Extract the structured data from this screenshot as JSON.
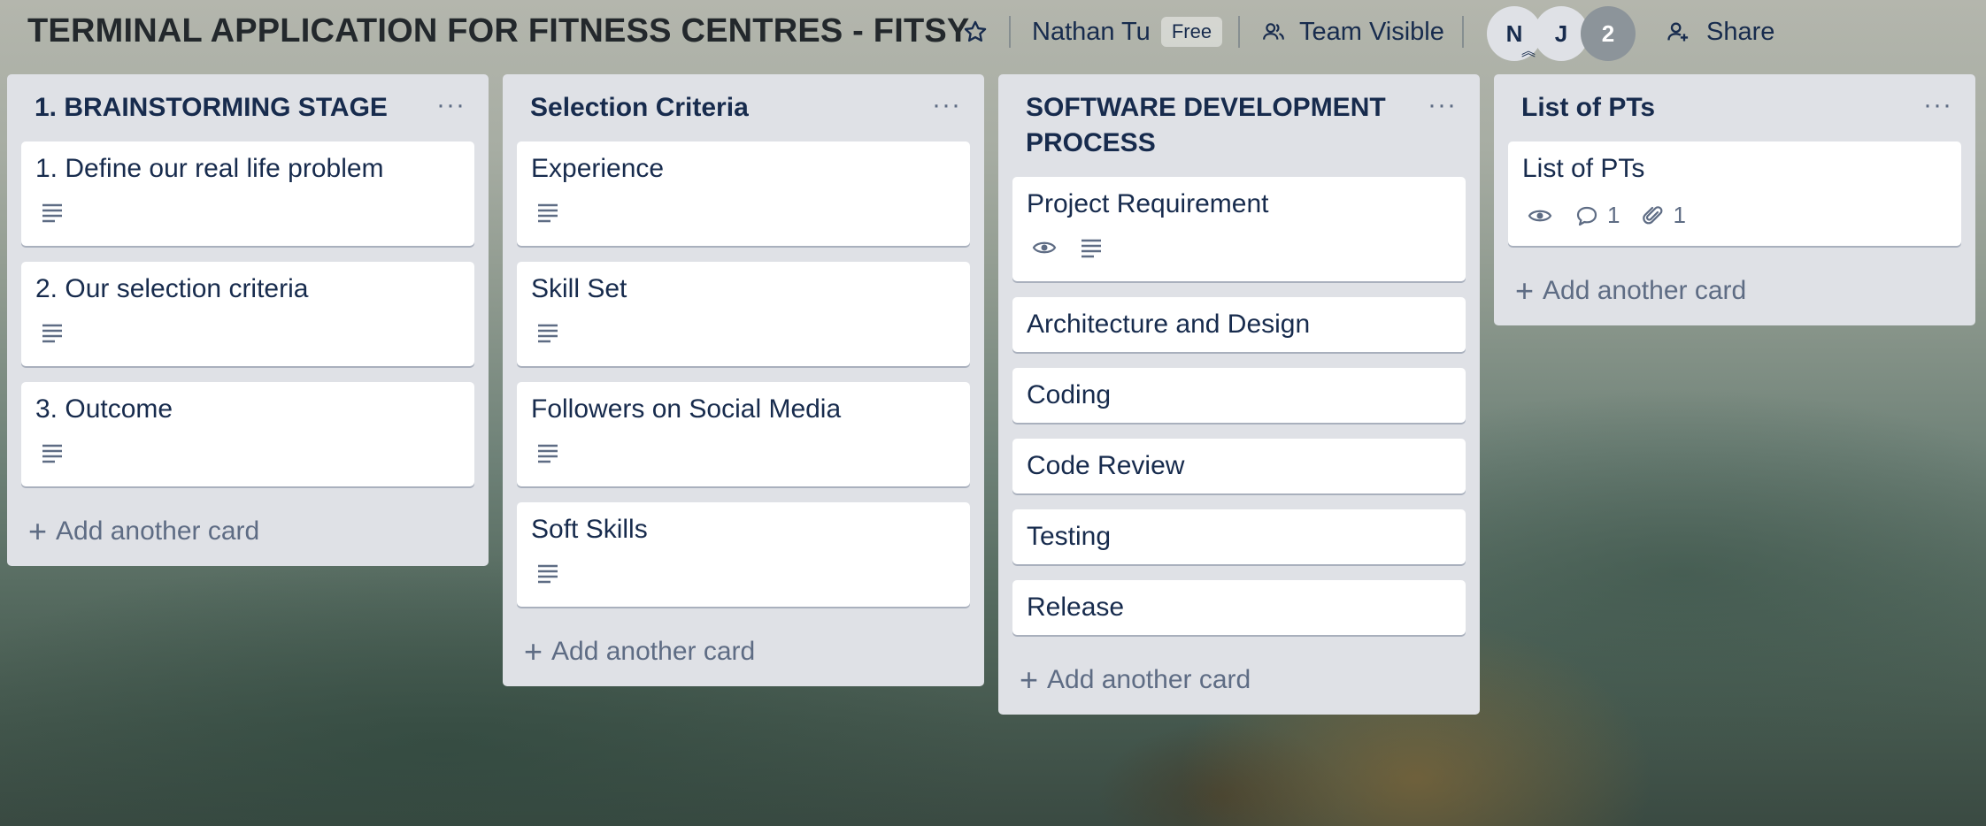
{
  "board": {
    "title": "TERMINAL APPLICATION FOR FITNESS CENTRES - FITSY",
    "owner": "Nathan Tu",
    "plan_badge": "Free",
    "visibility": "Team Visible",
    "members": [
      "N",
      "J"
    ],
    "extra_members_count": "2",
    "share_label": "Share"
  },
  "icons": {
    "star": "star-icon",
    "visibility": "team-icon",
    "share": "add-person-icon",
    "list_menu": "ellipsis-icon",
    "description": "description-icon",
    "watch": "eye-icon",
    "comment": "comment-icon",
    "attachment": "paperclip-icon",
    "add": "plus-icon"
  },
  "colors": {
    "list_bg": "#dfe1e6",
    "card_bg": "#ffffff",
    "text_primary": "#172b4d",
    "text_secondary": "#5e6c84"
  },
  "add_card_label": "Add another card",
  "list_menu_glyph": "···",
  "lists": [
    {
      "title": "1. BRAINSTORMING STAGE",
      "cards": [
        {
          "title": "1. Define our real life problem"
        },
        {
          "title": "2. Our selection criteria"
        },
        {
          "title": "3. Outcome"
        }
      ]
    },
    {
      "title": "Selection Criteria",
      "cards": [
        {
          "title": "Experience"
        },
        {
          "title": "Skill Set"
        },
        {
          "title": "Followers on Social Media"
        },
        {
          "title": "Soft Skills"
        }
      ]
    },
    {
      "title": "SOFTWARE DEVELOPMENT PROCESS",
      "cards": [
        {
          "title": "Project Requirement"
        },
        {
          "title": "Architecture and Design"
        },
        {
          "title": "Coding"
        },
        {
          "title": "Code Review"
        },
        {
          "title": "Testing"
        },
        {
          "title": "Release"
        }
      ]
    },
    {
      "title": "List of PTs",
      "cards": [
        {
          "title": "List of PTs",
          "comments": "1",
          "attachments": "1"
        }
      ]
    }
  ]
}
